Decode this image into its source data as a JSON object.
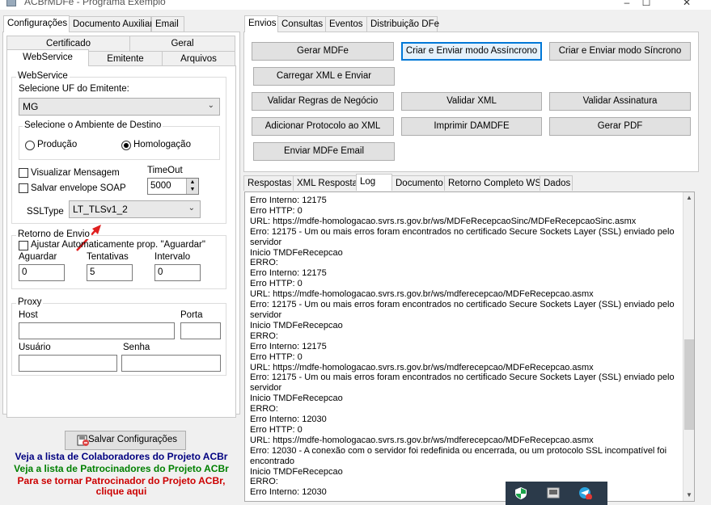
{
  "window": {
    "title": "ACBrMDFe - Programa Exemplo"
  },
  "left_tabs": [
    "Configurações",
    "Documento Auxiliar",
    "Email"
  ],
  "config_tabs_row1": [
    "Certificado",
    "Geral"
  ],
  "config_tabs_row2": [
    "WebService",
    "Emitente",
    "Arquivos"
  ],
  "webservice": {
    "group_label": "WebService",
    "uf_label": "Selecione UF do Emitente:",
    "uf_value": "MG",
    "ambiente_label": "Selecione o Ambiente de Destino",
    "producao": "Produção",
    "homologacao": "Homologação",
    "visualizar": "Visualizar Mensagem",
    "salvar_envelope": "Salvar envelope SOAP",
    "timeout_label": "TimeOut",
    "timeout_value": "5000",
    "ssltype_label": "SSLType",
    "ssltype_value": "LT_TLSv1_2"
  },
  "retorno": {
    "group_label": "Retorno de Envio",
    "ajustar": "Ajustar Automaticamente prop. \"Aguardar\"",
    "aguardar_label": "Aguardar",
    "tentativas_label": "Tentativas",
    "intervalo_label": "Intervalo",
    "aguardar_value": "0",
    "tentativas_value": "5",
    "intervalo_value": "0"
  },
  "proxy": {
    "group_label": "Proxy",
    "host_label": "Host",
    "porta_label": "Porta",
    "usuario_label": "Usuário",
    "senha_label": "Senha"
  },
  "save_button": "Salvar Configurações",
  "links": {
    "colaboradores": "Veja a lista de Colaboradores do Projeto ACBr",
    "patrocinadores": "Veja a lista de Patrocinadores do Projeto ACBr",
    "patrocinador_1": "Para se tornar Patrocinador do Projeto ACBr,",
    "patrocinador_2": "clique aqui"
  },
  "right_tabs": [
    "Envios",
    "Consultas",
    "Eventos",
    "Distribuição DFe"
  ],
  "buttons": {
    "gerar_mdfe": "Gerar MDFe",
    "criar_async": "Criar e Enviar modo Assíncrono",
    "criar_sync": "Criar e Enviar modo Síncrono",
    "carregar_xml": "Carregar XML e Enviar",
    "validar_regras": "Validar Regras de Negócio",
    "validar_xml": "Validar XML",
    "validar_assinatura": "Validar Assinatura",
    "adicionar_protocolo": "Adicionar Protocolo ao XML",
    "imprimir_damdfe": "Imprimir DAMDFE",
    "gerar_pdf": "Gerar PDF",
    "enviar_email": "Enviar MDFe Email"
  },
  "result_tabs": [
    "Respostas",
    "XML Resposta",
    "Log",
    "Documento",
    "Retorno Completo WS",
    "Dados"
  ],
  "log_lines": [
    "Erro Interno: 12175",
    "Erro HTTP: 0",
    "URL: https://mdfe-homologacao.svrs.rs.gov.br/ws/MDFeRecepcaoSinc/MDFeRecepcaoSinc.asmx",
    "Erro: 12175 - Um ou mais erros foram encontrados no certificado Secure Sockets Layer (SSL) enviado pelo",
    "servidor",
    "Inicio TMDFeRecepcao",
    "ERRO:",
    "Erro Interno: 12175",
    "Erro HTTP: 0",
    "URL: https://mdfe-homologacao.svrs.rs.gov.br/ws/mdferecepcao/MDFeRecepcao.asmx",
    "Erro: 12175 - Um ou mais erros foram encontrados no certificado Secure Sockets Layer (SSL) enviado pelo",
    "servidor",
    "Inicio TMDFeRecepcao",
    "ERRO:",
    "Erro Interno: 12175",
    "Erro HTTP: 0",
    "URL: https://mdfe-homologacao.svrs.rs.gov.br/ws/mdferecepcao/MDFeRecepcao.asmx",
    "Erro: 12175 - Um ou mais erros foram encontrados no certificado Secure Sockets Layer (SSL) enviado pelo",
    "servidor",
    "Inicio TMDFeRecepcao",
    "ERRO:",
    "Erro Interno: 12030",
    "Erro HTTP: 0",
    "URL: https://mdfe-homologacao.svrs.rs.gov.br/ws/mdferecepcao/MDFeRecepcao.asmx",
    "Erro: 12030 - A conexão com o servidor foi redefinida ou encerrada, ou um protocolo SSL incompatível foi",
    "encontrado",
    "Inicio TMDFeRecepcao",
    "ERRO:",
    "Erro Interno: 12030"
  ],
  "colors": {
    "link_blue": "#000080",
    "link_green": "#008000",
    "link_red": "#cc0000",
    "focus": "#0078d7",
    "arrow": "#e02020"
  }
}
